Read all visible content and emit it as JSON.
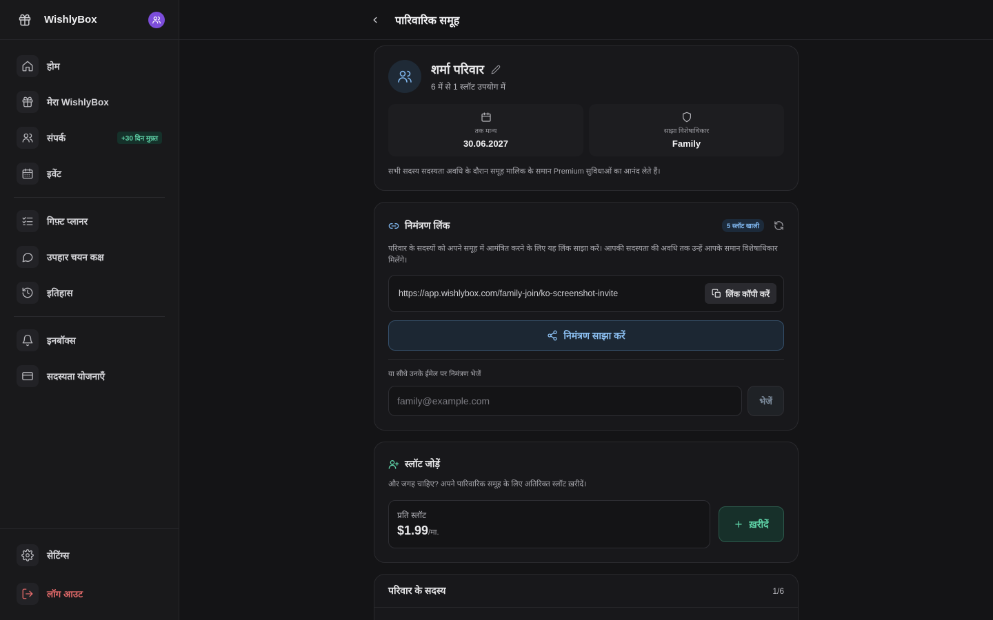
{
  "brand": {
    "name": "WishlyBox"
  },
  "sidebar": {
    "items": [
      {
        "label": "होम",
        "icon": "home-icon"
      },
      {
        "label": "मेरा WishlyBox",
        "icon": "gift-icon"
      },
      {
        "label": "संपर्क",
        "icon": "users-icon",
        "badge": "+30 दिन मुफ़्त"
      },
      {
        "label": "इवेंट",
        "icon": "calendar-icon"
      },
      {
        "label": "गिफ़्ट प्लानर",
        "icon": "checklist-icon"
      },
      {
        "label": "उपहार चयन कक्ष",
        "icon": "chat-icon"
      },
      {
        "label": "इतिहास",
        "icon": "history-icon"
      },
      {
        "label": "इनबॉक्स",
        "icon": "bell-icon"
      },
      {
        "label": "सदस्यता योजनाएँ",
        "icon": "credit-card-icon"
      }
    ],
    "settings": "सेटिंग्स",
    "logout": "लॉग आउट"
  },
  "header": {
    "title": "पारिवारिक समूह"
  },
  "group": {
    "name": "शर्मा परिवार",
    "usage": "6 में से 1 स्लॉट उपयोग में",
    "valid_label": "तक मान्य",
    "valid_value": "30.06.2027",
    "privilege_label": "साझा विशेषाधिकार",
    "privilege_value": "Family",
    "note": "सभी सदस्य सदस्यता अवधि के दौरान समूह मालिक के समान Premium सुविधाओं का आनंद लेते हैं।"
  },
  "invite": {
    "title": "निमंत्रण लिंक",
    "slots_free": "5 स्लॉट खाली",
    "description": "परिवार के सदस्यों को अपने समूह में आमंत्रित करने के लिए यह लिंक साझा करें। आपकी सदस्यता की अवधि तक उन्हें आपके समान विशेषाधिकार मिलेंगे।",
    "url": "https://app.wishlybox.com/family-join/ko-screenshot-invite",
    "copy_label": "लिंक कॉपी करें",
    "share_label": "निमंत्रण साझा करें",
    "email_label": "या सीधे उनके ईमेल पर निमंत्रण भेजें",
    "email_placeholder": "family@example.com",
    "send_label": "भेजें"
  },
  "slots": {
    "title": "स्लॉट जोड़ें",
    "description": "और जगह चाहिए? अपने पारिवारिक समूह के लिए अतिरिक्त स्लॉट ख़रीदें।",
    "price_label": "प्रति स्लॉट",
    "price": "$1.99",
    "per": "/मा.",
    "buy_label": "ख़रीदें"
  },
  "members": {
    "title": "परिवार के सदस्य",
    "count": "1/6"
  },
  "colors": {
    "accent_blue": "#7fb6ee",
    "accent_green": "#5fd3a8",
    "avatar_purple": "#7c4ddb",
    "danger": "#e36a6a"
  }
}
